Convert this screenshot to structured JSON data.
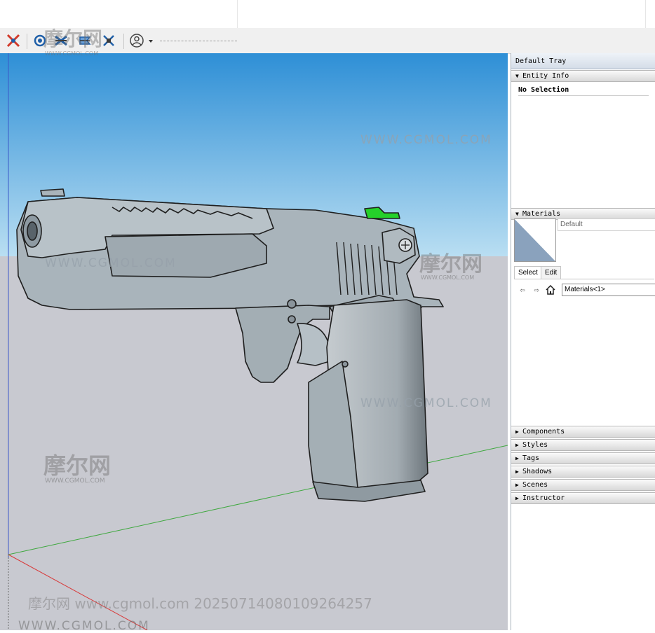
{
  "toolbar": {
    "icons": [
      "section-cut-icon",
      "section-fill-icon",
      "section-display-icon",
      "section-planes-icon",
      "section-cuts-icon",
      "account-icon"
    ],
    "colors": {
      "accent_red": "#d23a2a",
      "accent_blue": "#1f5fa8"
    }
  },
  "viewport": {
    "sky_top": "#2e8fd6",
    "sky_bottom": "#b9def2",
    "ground": "#c8c9d0",
    "model_fill": "#a9b4bb",
    "sight_color": "#25d12a"
  },
  "tray": {
    "title": "Default Tray",
    "entity_info": {
      "header": "Entity Info",
      "status": "No Selection"
    },
    "materials": {
      "header": "Materials",
      "current_name": "Default",
      "tab_select": "Select",
      "tab_edit": "Edit",
      "library": "Materials<1>"
    },
    "panels": [
      "Components",
      "Styles",
      "Tags",
      "Shadows",
      "Scenes",
      "Instructor"
    ]
  },
  "watermarks": {
    "url": "WWW.CGMOL.COM",
    "logo": "摩尔网",
    "logo_small": "WWW.CGMOL.COM",
    "footer": "摩尔网 www.cgmol.com 20250714080109264257"
  }
}
